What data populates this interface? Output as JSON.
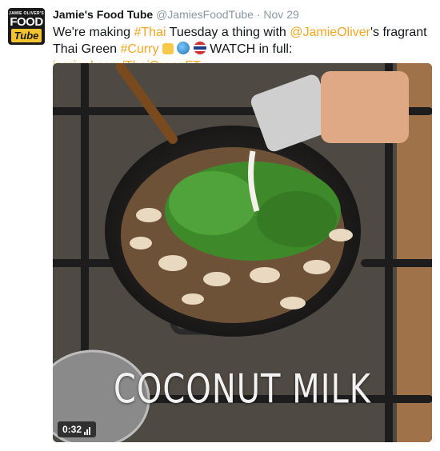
{
  "author": {
    "name": "Jamie's Food Tube",
    "handle": "@JamiesFoodTube",
    "separator": "·",
    "date": "Nov 29",
    "avatar": {
      "line1": "JAMIE OLIVER'S",
      "line2": "FOOD",
      "line3": "Tube"
    }
  },
  "tweet": {
    "t1": "We're making ",
    "hashtag_thai": "#Thai",
    "t2": " Tuesday a thing with ",
    "mention": "@JamieOliver",
    "t3": "'s fragrant Thai Green ",
    "hashtag_curry": "#Curry",
    "t4": " WATCH in full: ",
    "link": "jamieol.com/ThaiGreenFT"
  },
  "media": {
    "caption": "COCONUT MILK",
    "duration": "0:32"
  },
  "colors": {
    "link": "#f5a623",
    "avatar_yellow": "#f4c430"
  },
  "icons": [
    "raised-hands-emoji-icon",
    "globe-emoji-icon",
    "thai-flag-emoji-icon",
    "signal-bars-icon"
  ]
}
